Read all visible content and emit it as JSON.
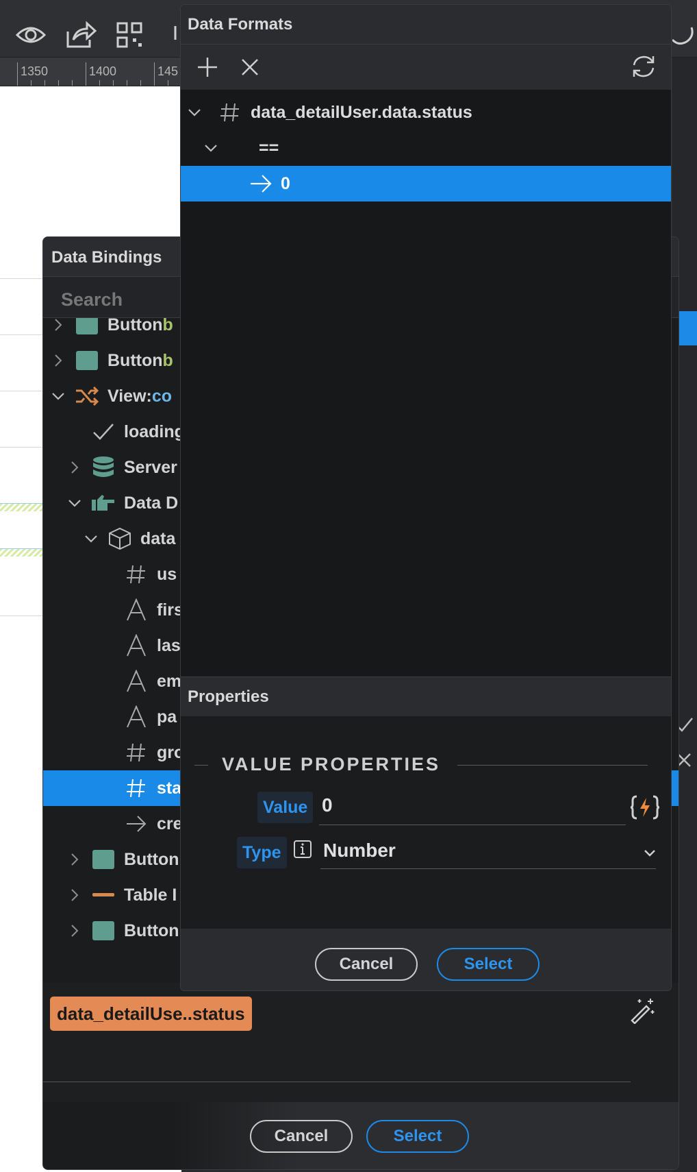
{
  "ruler": {
    "ticks": [
      "1350",
      "1400",
      "145"
    ]
  },
  "bindings_dialog": {
    "title": "Data Bindings",
    "search_placeholder": "Search",
    "tree": [
      {
        "label": "Button ",
        "suffix": "b",
        "icon": "square-icon"
      },
      {
        "label": "Button ",
        "suffix": "b",
        "icon": "square-icon"
      },
      {
        "label": "View: ",
        "suffix": "co",
        "icon": "shuffle-icon"
      },
      {
        "label": "loading",
        "icon": "check-icon"
      },
      {
        "label": "Server",
        "icon": "database-icon"
      },
      {
        "label": "Data D",
        "icon": "hand-pointer-icon"
      },
      {
        "label": "data",
        "icon": "cube-icon"
      },
      {
        "label": "us",
        "icon": "hash-icon"
      },
      {
        "label": "firs",
        "icon": "text-a-icon"
      },
      {
        "label": "las",
        "icon": "text-a-icon"
      },
      {
        "label": "em",
        "icon": "text-a-icon"
      },
      {
        "label": "pa",
        "icon": "text-a-icon"
      },
      {
        "label": "gro",
        "icon": "hash-icon"
      },
      {
        "label": "sta",
        "icon": "hash-icon"
      },
      {
        "label": "cre",
        "icon": "arrow-right-icon"
      },
      {
        "label": "Button",
        "icon": "square-icon"
      },
      {
        "label": "Table I",
        "icon": "dash-icon"
      },
      {
        "label": "Button",
        "icon": "square-icon"
      }
    ],
    "chip": "data_detailUse..status",
    "cancel_label": "Cancel",
    "select_label": "Select"
  },
  "formats_dialog": {
    "title": "Data Formats",
    "tree": [
      {
        "label": "data_detailUser.data.status",
        "icon": "hash-icon"
      },
      {
        "label": "=="
      },
      {
        "label": "0",
        "icon": "arrow-right-icon"
      }
    ],
    "properties_title": "Properties",
    "section_title": "VALUE PROPERTIES",
    "value_label": "Value",
    "value": "0",
    "type_label": "Type",
    "type_value": "Number",
    "cancel_label": "Cancel",
    "select_label": "Select"
  },
  "colors": {
    "accent": "#1a8ae8",
    "chip": "#e48a55",
    "tree_square": "#5f9d8e"
  }
}
